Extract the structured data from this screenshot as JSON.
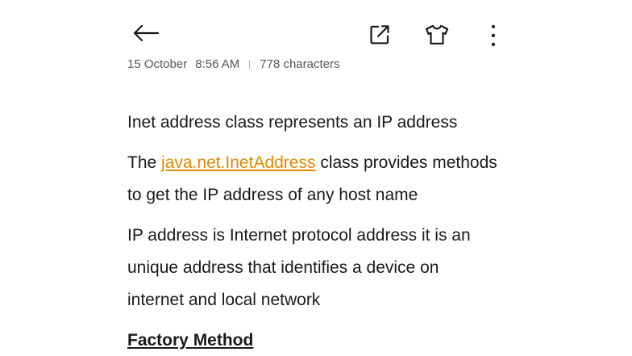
{
  "toolbar": {
    "back_icon": "arrow-left-icon",
    "share_icon": "external-share-icon",
    "theme_icon": "tshirt-theme-icon",
    "more_icon": "more-vertical-icon"
  },
  "meta": {
    "date": "15 October",
    "time": "8:56 AM",
    "char_count": "778 characters"
  },
  "note": {
    "p1": "Inet address class represents an IP address",
    "p2_prefix": "The ",
    "p2_link": "java.net.InetAddress",
    "p2_line1_rest": " class provides methods",
    "p2_line2": "to get the IP address of any host name",
    "p3_line1": "IP address is Internet protocol address  it is an",
    "p3_line2": "unique address that identifies a device on",
    "p3_line3": "internet and local network",
    "heading": "Factory Method"
  },
  "colors": {
    "link": "#e08a00",
    "text": "#1a1a1a",
    "meta": "#555555"
  }
}
